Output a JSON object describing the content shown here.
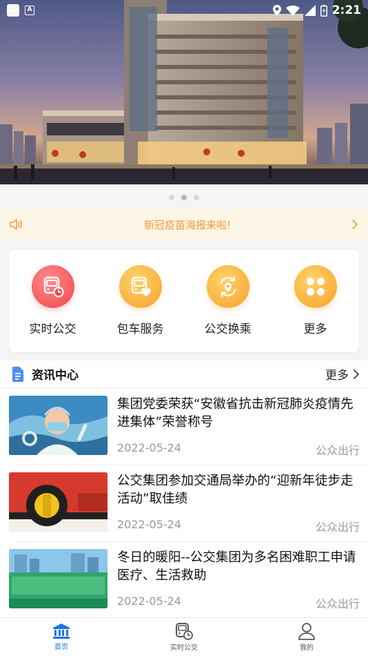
{
  "status_bar": {
    "time": "2:21"
  },
  "notice": {
    "text": "新冠疫苗海报来啦!"
  },
  "quick_actions": [
    {
      "label": "实时公交",
      "icon": "bus-clock-icon",
      "color": "#f0464d"
    },
    {
      "label": "包车服务",
      "icon": "bus-heart-icon",
      "color": "#f8a12b"
    },
    {
      "label": "公交换乘",
      "icon": "transfer-location-icon",
      "color": "#f8a12b"
    },
    {
      "label": "更多",
      "icon": "grid-more-icon",
      "color": "#f8a12b"
    }
  ],
  "news": {
    "title": "资讯中心",
    "more_label": "更多",
    "items": [
      {
        "title": "集团党委荣获“安徽省抗击新冠肺炎疫情先进集体”荣誉称号",
        "date": "2022-05-24",
        "source": "公众出行"
      },
      {
        "title": "公交集团参加交通局举办的“迎新年徒步走活动”取佳绩",
        "date": "2022-05-24",
        "source": "公众出行"
      },
      {
        "title": "冬日的暖阳--公交集团为多名困难职工申请医疗、生活救助",
        "date": "2022-05-24",
        "source": "公众出行"
      }
    ]
  },
  "tabbar": {
    "tabs": [
      {
        "label": "首页",
        "icon": "home-bank-icon",
        "active": true
      },
      {
        "label": "实时公交",
        "icon": "bus-clock-icon",
        "active": false
      },
      {
        "label": "我的",
        "icon": "user-icon",
        "active": false
      }
    ]
  },
  "colors": {
    "accent": "#1a72e6",
    "notice_text": "#f19a3a",
    "notice_bg": "#fdf5e6"
  }
}
